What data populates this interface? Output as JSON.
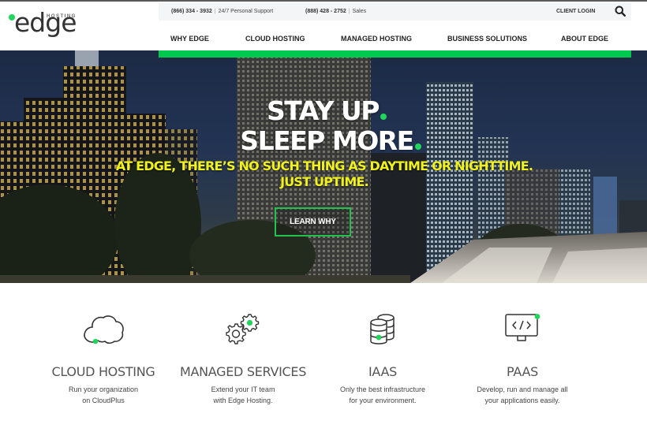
{
  "brand": {
    "logo_word": "edge",
    "logo_sub": "HOSTING",
    "accent_green": "#00c94f",
    "headline_yellow": "#f0f21a"
  },
  "utility_bar": {
    "support_phone": "(866) 334 - 3932",
    "support_label": "24/7 Personal Support",
    "sales_phone": "(888) 428 - 2752",
    "sales_label": "Sales",
    "separator": "|",
    "client_login": "CLIENT LOGIN",
    "search_icon": "search-icon"
  },
  "nav": {
    "items": [
      {
        "label": "WHY EDGE"
      },
      {
        "label": "CLOUD HOSTING"
      },
      {
        "label": "MANAGED HOSTING"
      },
      {
        "label": "BUSINESS SOLUTIONS"
      },
      {
        "label": "ABOUT EDGE"
      }
    ]
  },
  "hero": {
    "line1": "STAY UP",
    "line2": "SLEEP MORE",
    "sub1": "AT EDGE, THERE’S NO SUCH THING AS DAYTIME OR NIGHTTIME.",
    "sub2": "JUST UPTIME.",
    "cta": "LEARN WHY"
  },
  "features": [
    {
      "icon": "cloud-icon",
      "title": "CLOUD HOSTING",
      "desc1": "Run your organization",
      "desc2": "on CloudPlus"
    },
    {
      "icon": "gears-icon",
      "title": "MANAGED SERVICES",
      "desc1": "Extend your IT team",
      "desc2": "with Edge Hosting."
    },
    {
      "icon": "database-icon",
      "title": "IAAS",
      "desc1": "Only the best infrastructure",
      "desc2": "for your environment."
    },
    {
      "icon": "monitor-code-icon",
      "title": "PAAS",
      "desc1": "Develop, run and manage all",
      "desc2": "your applications easily."
    }
  ]
}
